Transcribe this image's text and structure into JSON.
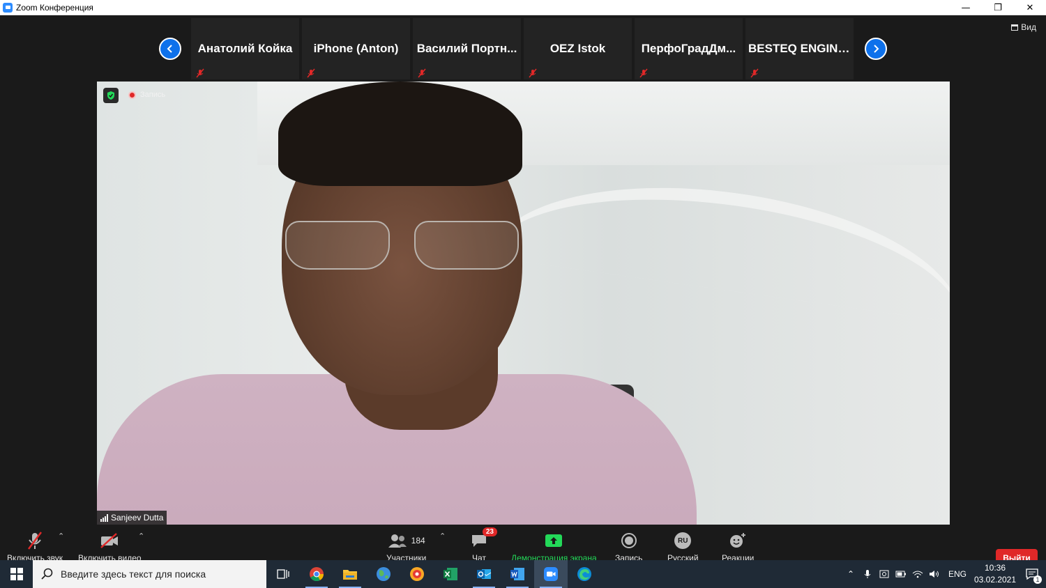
{
  "window": {
    "title": "Zoom Конференция",
    "minimize": "—",
    "restore": "❐",
    "close": "✕"
  },
  "view": {
    "label": "Вид"
  },
  "participants_strip": [
    {
      "name": "Анатолий Койка"
    },
    {
      "name": "iPhone (Anton)"
    },
    {
      "name": "Василий  Портн..."
    },
    {
      "name": "OEZ Istok"
    },
    {
      "name": "ПерфоГрадДм..."
    },
    {
      "name": "BESTEQ  ENGINE..."
    }
  ],
  "video": {
    "recording_label": "Запись",
    "speaker_name": "Sanjeev Dutta"
  },
  "toolbar": {
    "audio": "Включить звук",
    "video": "Включить видео",
    "participants": "Участники",
    "participants_count": "184",
    "chat": "Чат",
    "chat_badge": "23",
    "share": "Демонстрация экрана",
    "record": "Запись",
    "language": "Русский",
    "language_code": "RU",
    "reactions": "Реакции",
    "leave": "Выйти"
  },
  "taskbar": {
    "search_placeholder": "Введите здесь текст для поиска",
    "lang": "ENG",
    "time": "10:36",
    "date": "03.02.2021",
    "notifications": "1"
  },
  "colors": {
    "accent": "#0e71eb",
    "share_green": "#23d959",
    "leave_red": "#e02828"
  }
}
